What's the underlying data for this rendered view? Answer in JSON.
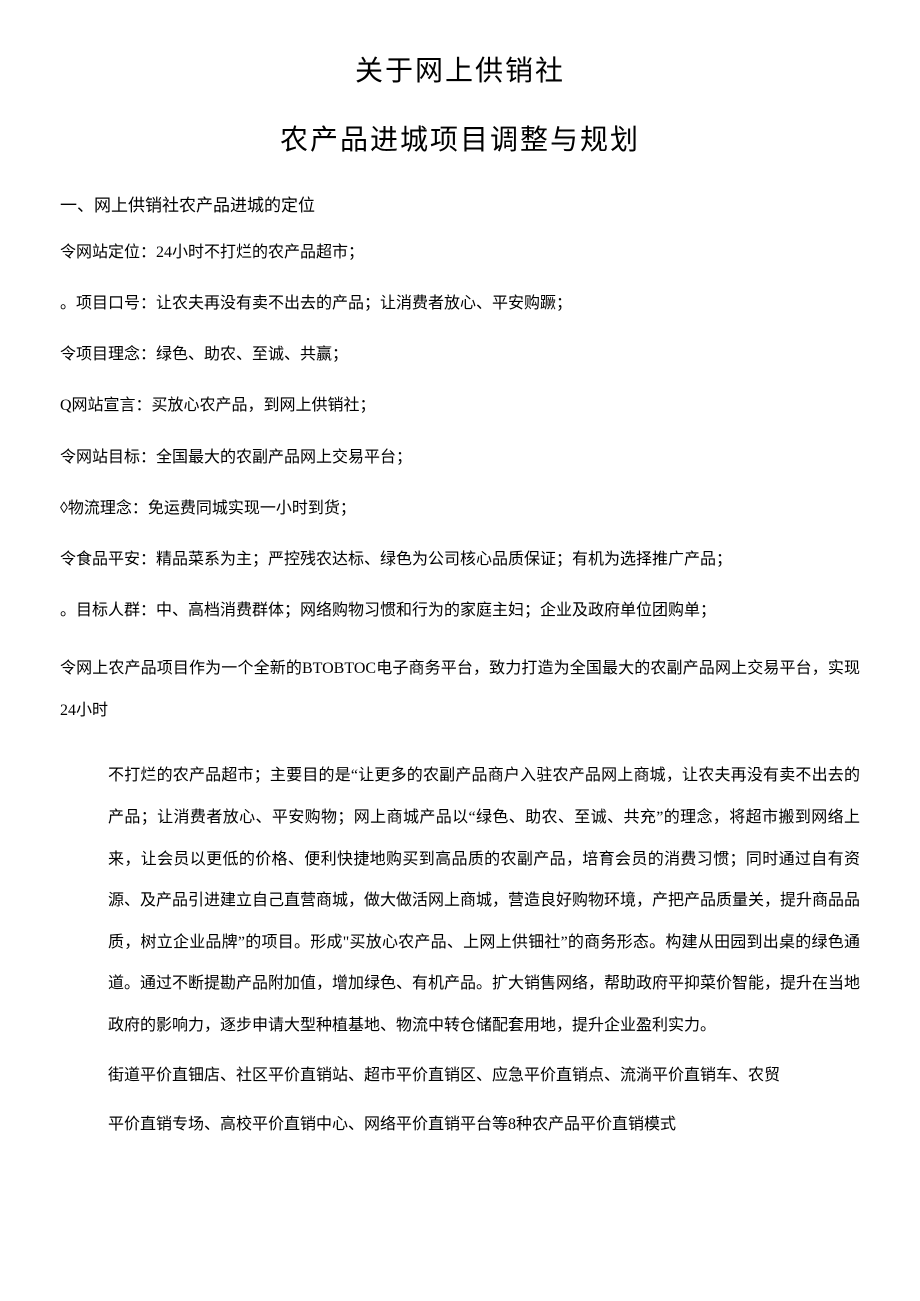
{
  "title1": "关于网上供销社",
  "title2": "农产品进城项目调整与规划",
  "section1": {
    "heading": "一、网上供销社农产品进城的定位",
    "items": [
      "令网站定位：24小时不打烂的农产品超市；",
      "。项目口号：让农夫再没有卖不出去的产品；让消费者放心、平安购蹶；",
      "令项目理念：绿色、助农、至诚、共赢；",
      "Q网站宣言：买放心农产品，到网上供销社；",
      "令网站目标：全国最大的农副产品网上交易平台；",
      "◊物流理念：免运费同城实现一小时到货；",
      "令食品平安：精品菜系为主；严控残农达标、绿色为公司核心品质保证；有机为选择推广产品；",
      "。目标人群：中、高档消费群体；网络购物习惯和行为的家庭主妇；企业及政府单位团购单；"
    ],
    "paragraph_lead": "令网上农产品项目作为一个全新的BTOBTOC电子商务平台，致力打造为全国最大的农副产品网上交易平台，实现24小时",
    "paragraph_body": "不打烂的农产品超市；主要目的是“让更多的农副产品商户入驻农产品网上商城，让农夫再没有卖不出去的产品；让消费者放心、平安购物；网上商城产品以“绿色、助农、至诚、共充”的理念，将超市搬到网络上来，让会员以更低的价格、便利快捷地购买到高品质的农副产品，培育会员的消费习惯；同时通过自有资源、及产品引进建立自己直营商城，做大做活网上商城，营造良好购物环境，产把产品质量关，提升商品品质，树立企业品牌”的项目。形成\"买放心农产品、上网上供钿社”的商务形态。构建从田园到出桌的绿色通道。通过不断提勘产品附加值，增加绿色、有机产品。扩大销售网络，帮助政府平抑菜价智能，提升在当地政府的影响力，逐步申请大型种植基地、物流中转仓储配套用地，提升企业盈利实力。",
    "paragraph_tail1": "街道平价直钿店、社区平价直销站、超市平价直销区、应急平价直销点、流淌平价直销车、农贸",
    "paragraph_tail2": "平价直销专场、高校平价直销中心、网络平价直销平台等8种农产品平价直销模式"
  }
}
